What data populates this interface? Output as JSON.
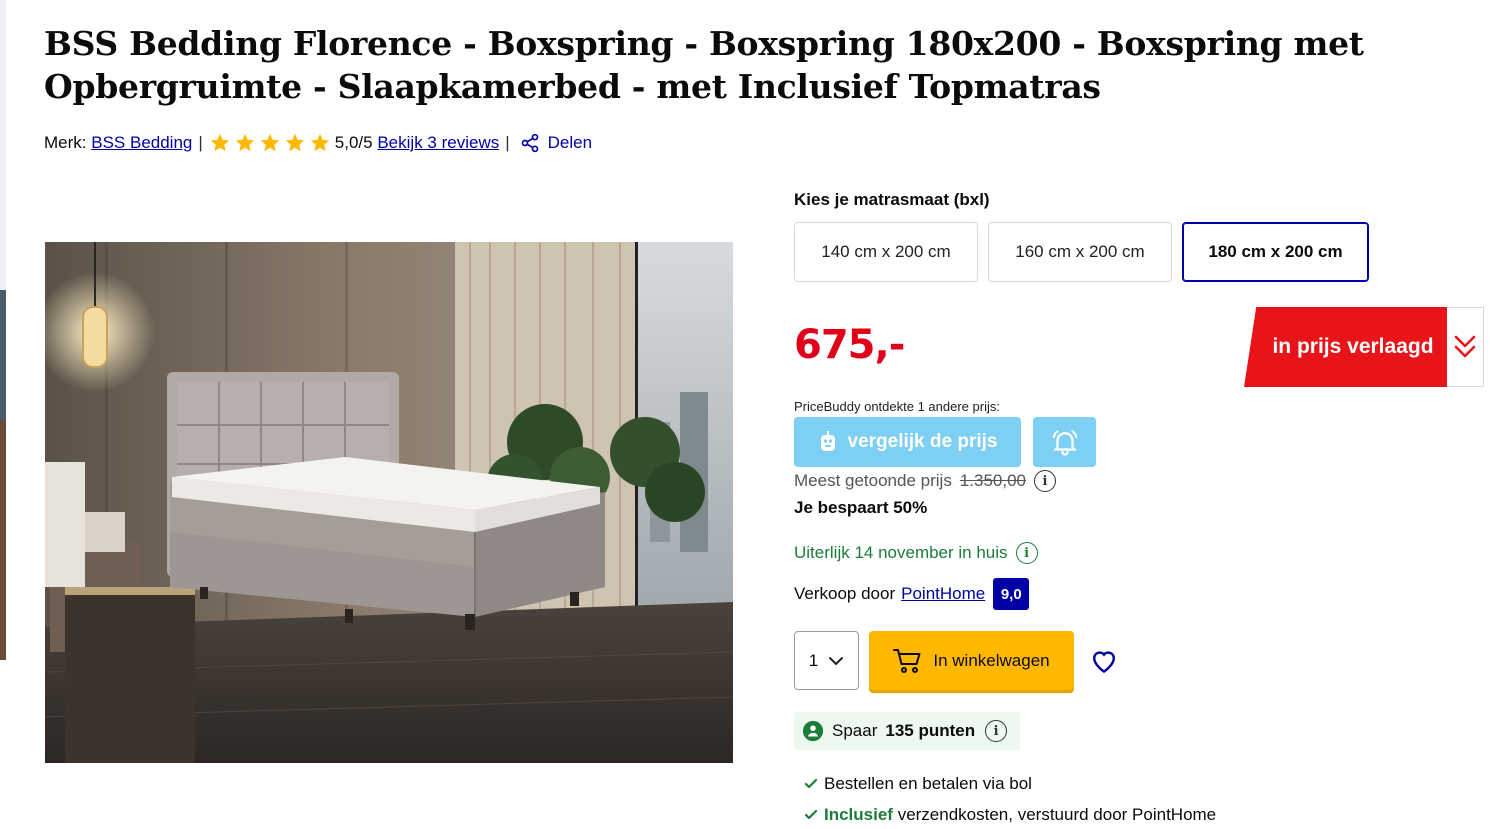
{
  "product": {
    "title": "BSS Bedding Florence - Boxspring - Boxspring 180x200 - Boxspring met Opbergruimte - Slaapkamerbed - met Inclusief Topmatras"
  },
  "meta": {
    "brand_label": "Merk:",
    "brand_name": "BSS Bedding",
    "separator": "|",
    "rating_text": "5,0/5",
    "rating_value": 5,
    "rating_max": 5,
    "reviews_link": "Bekijk 3 reviews",
    "share_label": "Delen"
  },
  "size_selector": {
    "label": "Kies je matrasmaat (bxl)",
    "options": [
      "140 cm x 200 cm",
      "160 cm x 200 cm",
      "180 cm x 200 cm"
    ],
    "selected": "180 cm x 200 cm"
  },
  "pricing": {
    "price": "675,-",
    "promo_label": "in prijs verlaagd",
    "pricebuddy_label": "PriceBuddy ontdekte 1 andere prijs:",
    "compare_button": "vergelijk de prijs",
    "most_shown_label": "Meest getoonde prijs",
    "most_shown_price": "1.350,00",
    "saving_text": "Je bespaart 50%"
  },
  "delivery": {
    "text": "Uiterlijk 14 november in huis"
  },
  "seller": {
    "label": "Verkoop door",
    "name": "PointHome",
    "rating": "9,0"
  },
  "purchase": {
    "quantity": "1",
    "cart_button": "In winkelwagen"
  },
  "points": {
    "label": "Spaar",
    "amount": "135 punten"
  },
  "usps": [
    {
      "bold": "",
      "text": "Bestellen en betalen via bol"
    },
    {
      "bold": "Inclusief",
      "text": " verzendkosten, verstuurd door PointHome"
    }
  ],
  "colors": {
    "link_blue": "#0000a4",
    "price_red": "#e0001a",
    "promo_red": "#e8141a",
    "cart_yellow": "#ffb800",
    "pricebuddy_blue": "#7dd0f3",
    "delivery_green": "#1c7c3a",
    "star_yellow": "#ffb800"
  },
  "icons": [
    "star-icon",
    "share-icon",
    "chevron-double-down-icon",
    "pricebuddy-icon",
    "bell-icon",
    "info-icon",
    "chevron-down-icon",
    "cart-icon",
    "heart-icon",
    "points-icon",
    "check-icon"
  ]
}
